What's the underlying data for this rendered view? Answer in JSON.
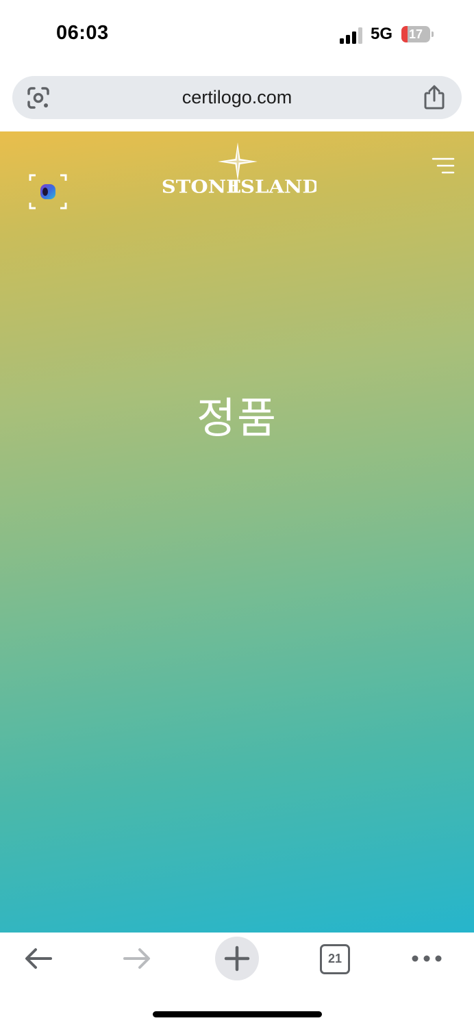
{
  "status_bar": {
    "time": "06:03",
    "network": "5G",
    "battery_level": "17",
    "battery_fraction": 0.17,
    "battery_color": "#e8423f"
  },
  "browser": {
    "url": "certilogo.com",
    "icons": {
      "lens": "google-lens-icon",
      "share": "share-icon"
    }
  },
  "page": {
    "logo": {
      "word_left": "STONE",
      "word_right": "ISLAND"
    },
    "status_text": "정품",
    "icons": {
      "scan": "scan-icon",
      "menu": "hamburger-menu-icon"
    },
    "colors": {
      "gradient_top": "#e9be4c",
      "gradient_bottom": "#26b5cc"
    }
  },
  "toolbar": {
    "tab_count": "21",
    "icons": {
      "back": "back-arrow-icon",
      "forward": "forward-arrow-icon",
      "new_tab": "plus-icon",
      "tabs": "tab-switcher-icon",
      "more": "more-dots-icon"
    }
  }
}
